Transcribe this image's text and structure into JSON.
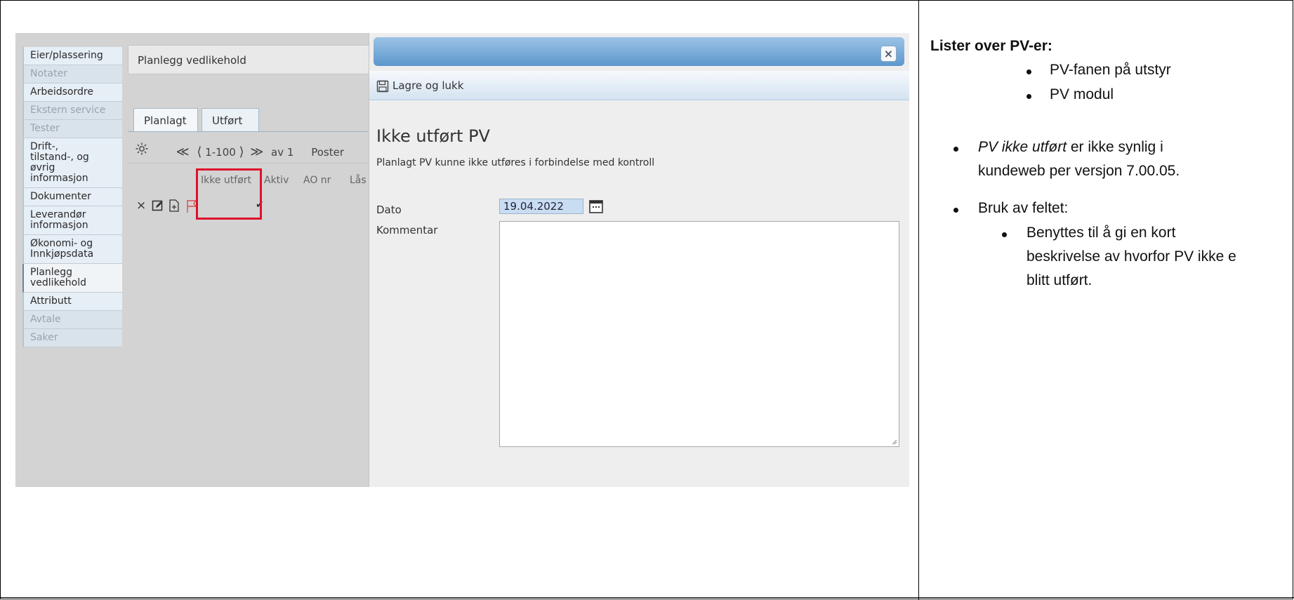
{
  "sidebar": {
    "items": [
      {
        "label": "Eier/plassering",
        "state": "normal"
      },
      {
        "label": "Notater",
        "state": "dim"
      },
      {
        "label": "Arbeidsordre",
        "state": "normal"
      },
      {
        "label": "Ekstern service",
        "state": "dim"
      },
      {
        "label": "Tester",
        "state": "dim"
      },
      {
        "label": "Drift-,\ntilstand-, og\nøvrig\ninformasjon",
        "state": "normal"
      },
      {
        "label": "Dokumenter",
        "state": "normal"
      },
      {
        "label": "Leverandør\ninformasjon",
        "state": "normal"
      },
      {
        "label": "Økonomi- og\nInnkjøpsdata",
        "state": "normal"
      },
      {
        "label": "Planlegg\nvedlikehold",
        "state": "active"
      },
      {
        "label": "Attributt",
        "state": "normal"
      },
      {
        "label": "Avtale",
        "state": "dim"
      },
      {
        "label": "Saker",
        "state": "dim"
      }
    ]
  },
  "main": {
    "header": "Planlegg vedlikehold",
    "tabs": [
      "Planlagt",
      "Utført"
    ],
    "pager": {
      "first": "≪",
      "prev": "⟨",
      "range": "1-100",
      "next": "⟩",
      "last": "≫",
      "of": "av 1",
      "poster": "Poster"
    },
    "columns": [
      "Ikke utført",
      "Aktiv",
      "AO nr",
      "Lås"
    ],
    "row": {
      "aktiv": "✔"
    }
  },
  "dialog": {
    "save_label": "Lagre og lukk",
    "heading": "Ikke utført PV",
    "subtitle": "Planlagt PV kunne ikke utføres i forbindelse med kontroll",
    "date_label": "Dato",
    "date_value": "19.04.2022",
    "comment_label": "Kommentar",
    "close": "×"
  },
  "notes": {
    "title": "Lister over PV-er:",
    "list1": [
      "PV-fanen på utstyr",
      "PV modul"
    ],
    "para1_em": "PV ikke utført",
    "para1_rest": " er ikke synlig i",
    "para1_line2": "kundeweb per versjon 7.00.05.",
    "bruk": "Bruk av feltet:",
    "sub_lines": [
      "Benyttes til å gi en kort",
      "beskrivelse av hvorfor PV ikke e",
      "blitt utført."
    ]
  },
  "colors": {
    "highlight": "#e0102a",
    "dialog_title": "#5d97cc"
  }
}
